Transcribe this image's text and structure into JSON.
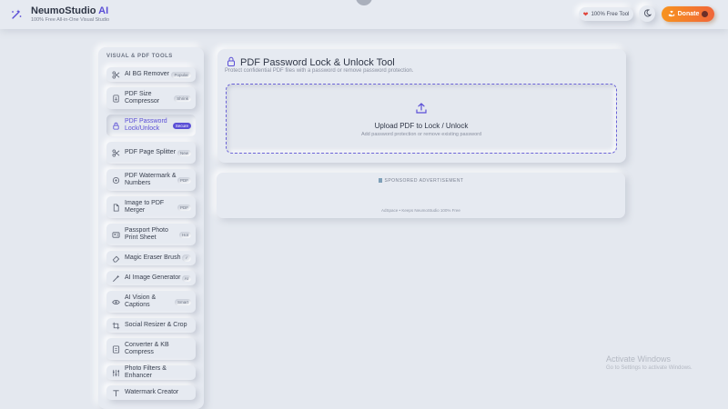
{
  "header": {
    "brand_name": "NeumoStudio",
    "brand_accent": "AI",
    "brand_tagline": "100% Free All-in-One Visual Studio",
    "free_badge": "100% Free Tool",
    "donate_label": "Donate"
  },
  "sidebar": {
    "title": "VISUAL & PDF TOOLS",
    "items": [
      {
        "label": "AI BG Remover",
        "tag": "Popular",
        "icon": "scissors-icon"
      },
      {
        "label": "PDF Size Compressor",
        "tag": "Shrink",
        "icon": "compress-icon"
      },
      {
        "label": "PDF Password Lock/Unlock",
        "tag": "Secure",
        "icon": "lock-icon",
        "active": true
      },
      {
        "label": "PDF Page Splitter",
        "tag": "New",
        "icon": "scissors-icon"
      },
      {
        "label": "PDF Watermark & Numbers",
        "tag": "PDF",
        "icon": "stamp-icon"
      },
      {
        "label": "Image to PDF Merger",
        "tag": "PDF",
        "icon": "file-icon"
      },
      {
        "label": "Passport Photo Print Sheet",
        "tag": "Hot",
        "icon": "id-card-icon"
      },
      {
        "label": "Magic Eraser Brush",
        "tag": "✓",
        "icon": "eraser-icon"
      },
      {
        "label": "AI Image Generator",
        "tag": "AI",
        "icon": "wand-icon"
      },
      {
        "label": "AI Vision & Captions",
        "tag": "Smart",
        "icon": "eye-icon"
      },
      {
        "label": "Social Resizer & Crop",
        "tag": "",
        "icon": "crop-icon"
      },
      {
        "label": "Converter & KB Compress",
        "tag": "",
        "icon": "convert-icon"
      },
      {
        "label": "Photo Filters & Enhancer",
        "tag": "",
        "icon": "sliders-icon"
      },
      {
        "label": "Watermark Creator",
        "tag": "",
        "icon": "text-icon"
      }
    ]
  },
  "main": {
    "title": "PDF Password Lock & Unlock Tool",
    "description": "Protect confidential PDF files with a password or remove password protection.",
    "upload_title": "Upload PDF to Lock / Unlock",
    "upload_subtitle": "Add password protection or remove existing password"
  },
  "ad": {
    "label": "SPONSORED ADVERTISEMENT",
    "footer": "AdSpace • Keeps NeumoStudio 100% Free"
  },
  "watermark": {
    "line1": "Activate Windows",
    "line2": "Go to Settings to activate Windows."
  },
  "colors": {
    "accent": "#5b4fd6",
    "donate_gradient_start": "#f7931e",
    "donate_gradient_end": "#f0663a",
    "background": "#e4e8ef"
  }
}
